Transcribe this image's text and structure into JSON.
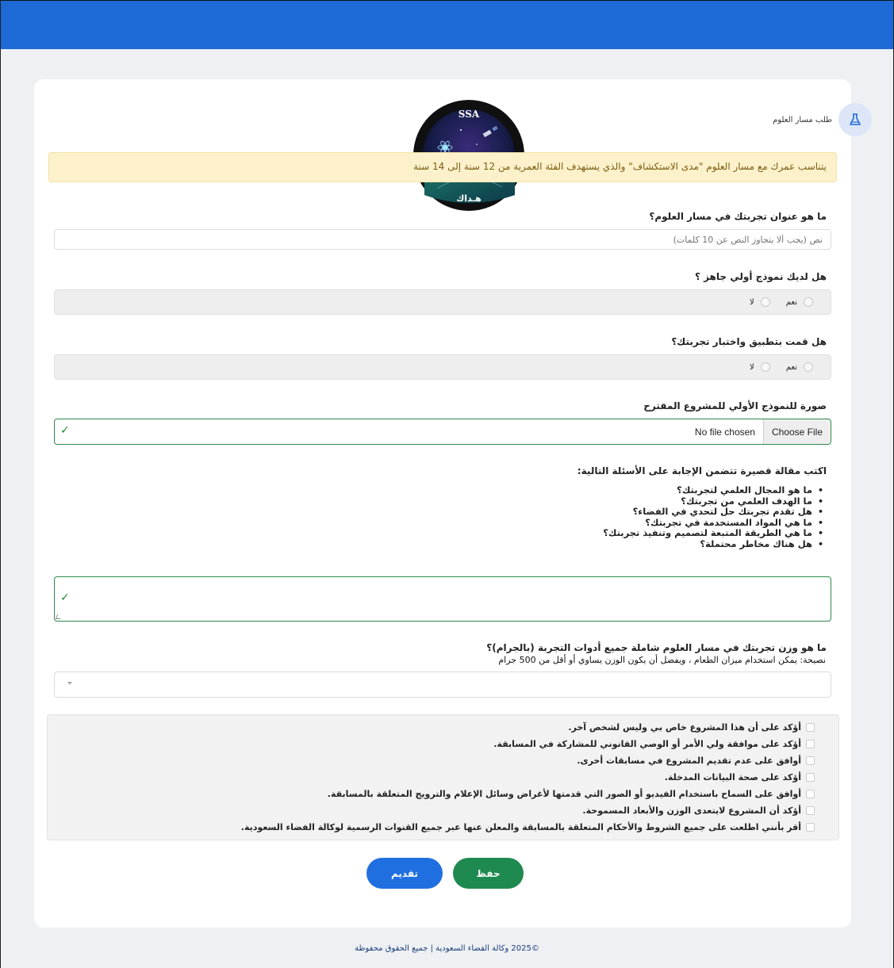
{
  "colors": {
    "brand_blue": "#1d6ad6",
    "success_green": "#1f8a50",
    "notice_bg": "#fdf1cc",
    "notice_text": "#7a5d10"
  },
  "logo": {
    "top_text": "SSA",
    "bottom_text": "هـداك"
  },
  "header": {
    "title": "طلب مسار العلوم",
    "icon": "flask-icon"
  },
  "notice": {
    "text": "يتناسب عمرك مع مسار العلوم \"مدى الاستكشاف\" والذي يستهدف الفئة العمرية من 12 سنة إلى 14 سنة"
  },
  "form": {
    "title_question": {
      "label": "ما هو عنوان تجربتك في مسار العلوم؟",
      "placeholder": "نص (يجب ألا يتجاوز النص عن 10 كلمات)"
    },
    "prototype_question": {
      "label": "هل لديك نموذج أولي جاهز ؟",
      "options": [
        "نعم",
        "لا"
      ]
    },
    "tested_question": {
      "label": "هل قمت بتطبيق واختبار تجربتك؟",
      "options": [
        "نعم",
        "لا"
      ]
    },
    "image_upload": {
      "label": "صورة للنموذج الأولي للمشروع المقترح",
      "button": "Choose File",
      "status": "No file chosen"
    },
    "essay": {
      "label": "اكتب مقالة قصيرة تتضمن الإجابة على الأسئلة التالية:",
      "questions": [
        "ما هو المجال العلمي لتجربتك؟",
        "ما الهدف العلمي من تجربتك؟",
        "هل تقدم تجربتك حل لتحدي في الفضاء؟",
        "ما هي المواد المستخدمة في تجربتك؟",
        "ما هي الطريقة المتبعة لتصميم وتنفيذ تجربتك؟",
        "هل هناك مخاطر محتملة؟"
      ]
    },
    "weight": {
      "label": "ما هو وزن تجربتك في مسار العلوم شاملة جميع أدوات التجربة (بالجرام)؟",
      "hint": "نصيحة: يمكن استخدام ميزان الطعام ، ويفضل أن يكون الوزن يساوي أو أقل من  500  جرام"
    },
    "agreements": [
      "أؤكد على أن هذا المشروع خاص بي وليس لشخص آخر.",
      "أؤكد على موافقة ولي الأمر أو الوصي القانوني للمشاركة في المسابقة.",
      "أوافق على عدم تقديم المشروع في مسابقات أخرى.",
      "أؤكد على صحة البيانات المدخلة.",
      "أوافق على السماح باستخدام الفيديو أو الصور التي قدمتها لأغراض وسائل الإعلام والترويج المتعلقة بالمسابقة.",
      "أؤكد أن المشروع لايتعدى الوزن والأبعاد المسموحة.",
      "أقر بأنني اطلعت على جميع الشروط والأحكام المتعلقة بالمسابقة والمعلن عنها عبر جميع القنوات الرسمية لوكالة الفضاء السعودية."
    ]
  },
  "buttons": {
    "save": "حفظ",
    "submit": "تقديم"
  },
  "footer": {
    "text": "©2025 وكالة الفضاء السعودية | جميع الحقوق محفوظة"
  }
}
